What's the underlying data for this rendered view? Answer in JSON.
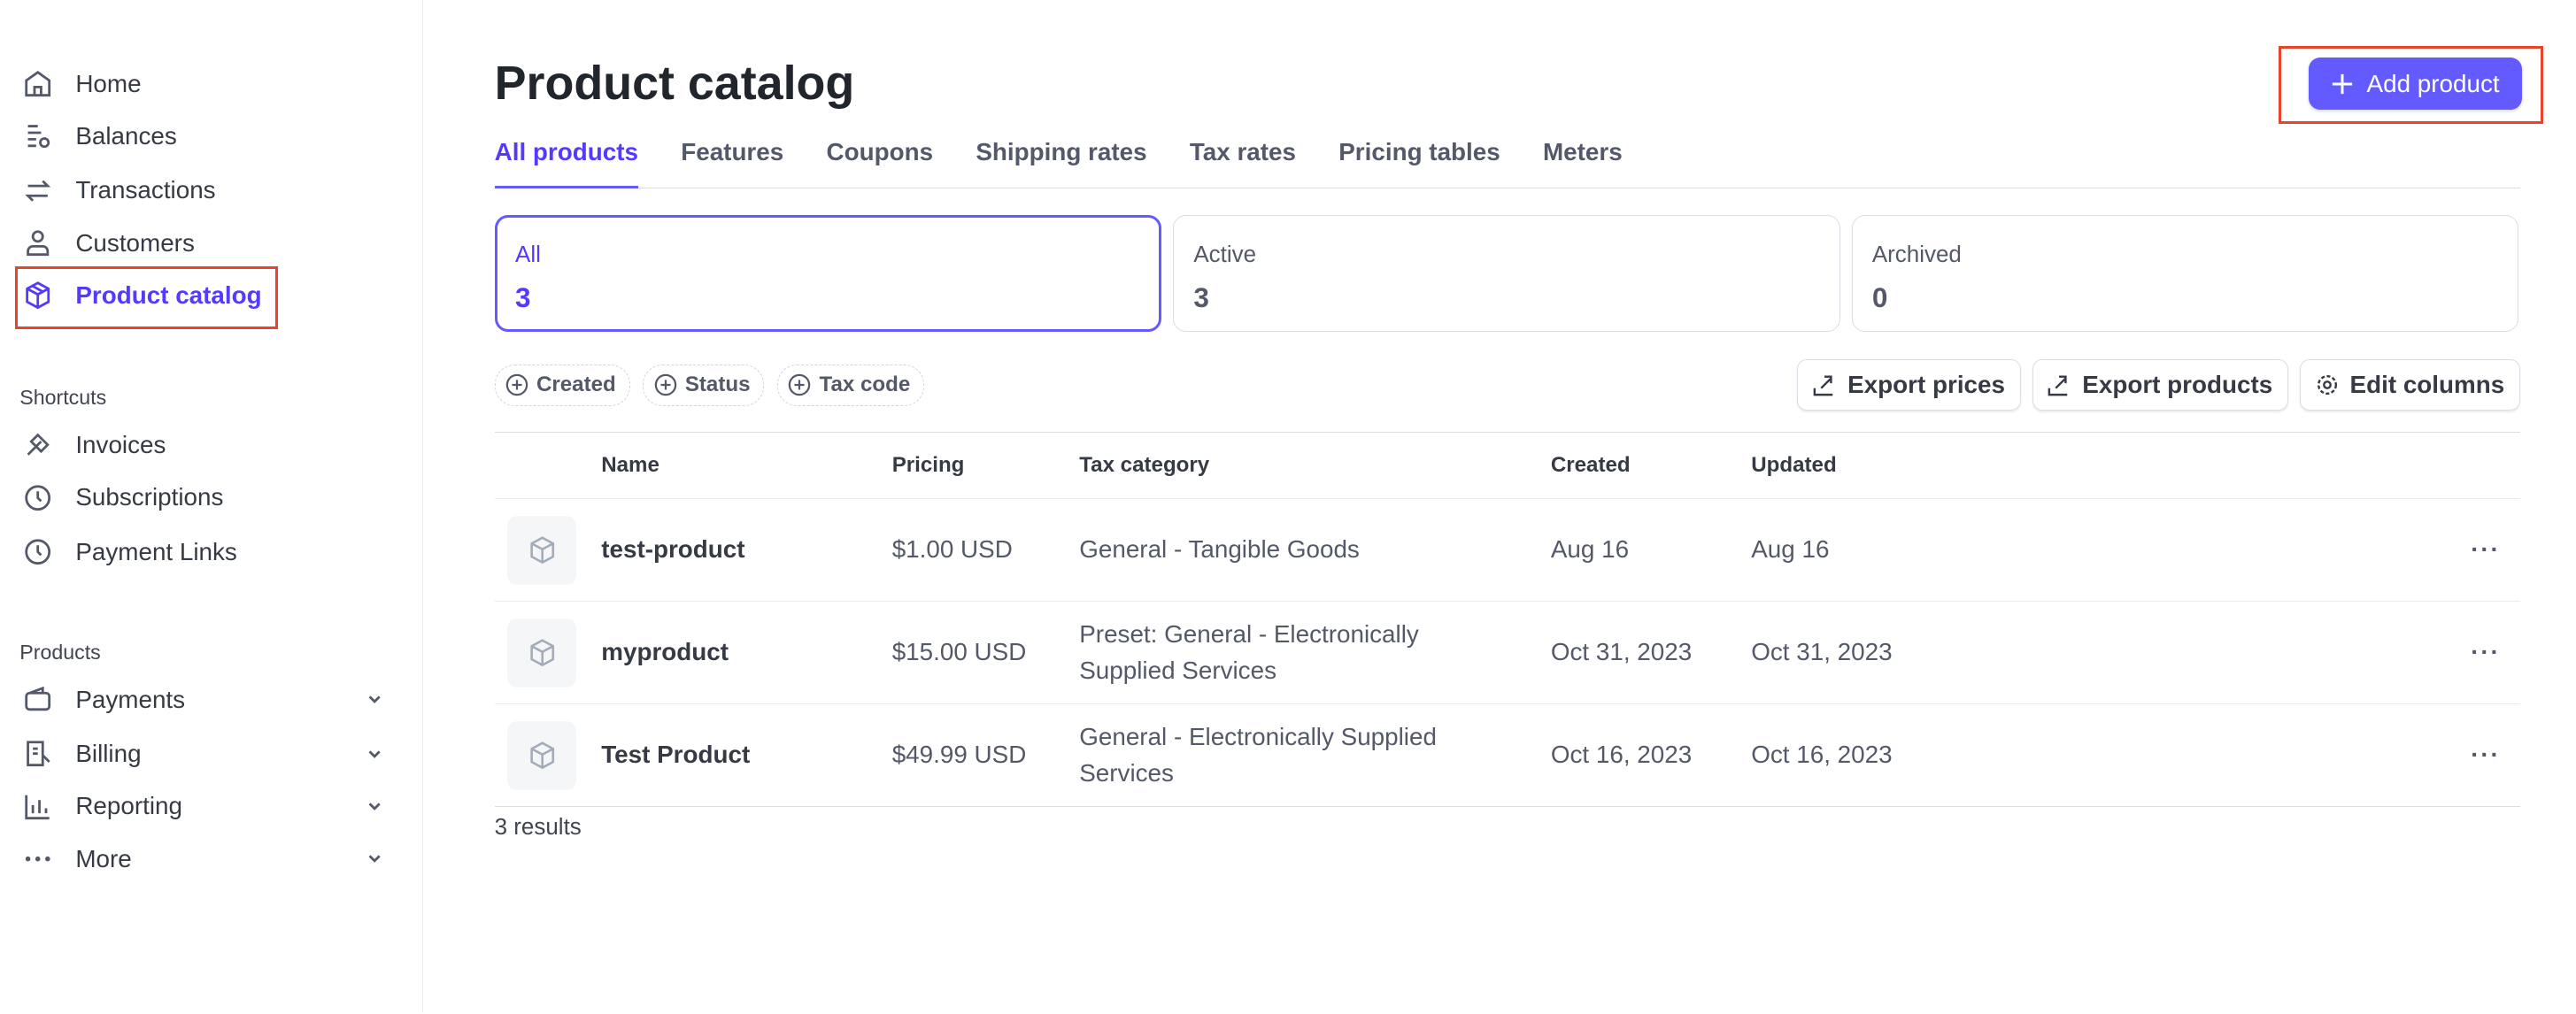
{
  "sidebar": {
    "items": [
      {
        "label": "Home",
        "icon": "home-icon"
      },
      {
        "label": "Balances",
        "icon": "balances-icon"
      },
      {
        "label": "Transactions",
        "icon": "transactions-icon"
      },
      {
        "label": "Customers",
        "icon": "person-icon"
      },
      {
        "label": "Product catalog",
        "icon": "box-icon",
        "active": true
      }
    ],
    "shortcuts_title": "Shortcuts",
    "shortcuts": [
      {
        "label": "Invoices",
        "icon": "invoice-icon"
      },
      {
        "label": "Subscriptions",
        "icon": "clock-icon"
      },
      {
        "label": "Payment Links",
        "icon": "clock-icon"
      }
    ],
    "products_title": "Products",
    "products": [
      {
        "label": "Payments",
        "icon": "wallet-icon"
      },
      {
        "label": "Billing",
        "icon": "billing-icon"
      },
      {
        "label": "Reporting",
        "icon": "chart-icon"
      },
      {
        "label": "More",
        "icon": "more-icon"
      }
    ]
  },
  "header": {
    "title": "Product catalog",
    "add_button": "Add product"
  },
  "tabs": [
    "All products",
    "Features",
    "Coupons",
    "Shipping rates",
    "Tax rates",
    "Pricing tables",
    "Meters"
  ],
  "status_cards": [
    {
      "label": "All",
      "count": "3"
    },
    {
      "label": "Active",
      "count": "3"
    },
    {
      "label": "Archived",
      "count": "0"
    }
  ],
  "filters": [
    "Created",
    "Status",
    "Tax code"
  ],
  "actions": {
    "export_prices": "Export prices",
    "export_products": "Export products",
    "edit_columns": "Edit columns"
  },
  "table": {
    "columns": [
      "Name",
      "Pricing",
      "Tax category",
      "Created",
      "Updated"
    ],
    "rows": [
      {
        "name": "test-product",
        "pricing": "$1.00 USD",
        "tax": "General - Tangible Goods",
        "created": "Aug 16",
        "updated": "Aug 16"
      },
      {
        "name": "myproduct",
        "pricing": "$15.00 USD",
        "tax": "Preset: General - Electronically Supplied Services",
        "created": "Oct 31, 2023",
        "updated": "Oct 31, 2023"
      },
      {
        "name": "Test Product",
        "pricing": "$49.99 USD",
        "tax": "General - Electronically Supplied Services",
        "created": "Oct 16, 2023",
        "updated": "Oct 16, 2023"
      }
    ],
    "more_label": "···"
  },
  "results": "3 results",
  "colors": {
    "accent": "#635bff",
    "annotation": "#e8432d"
  }
}
